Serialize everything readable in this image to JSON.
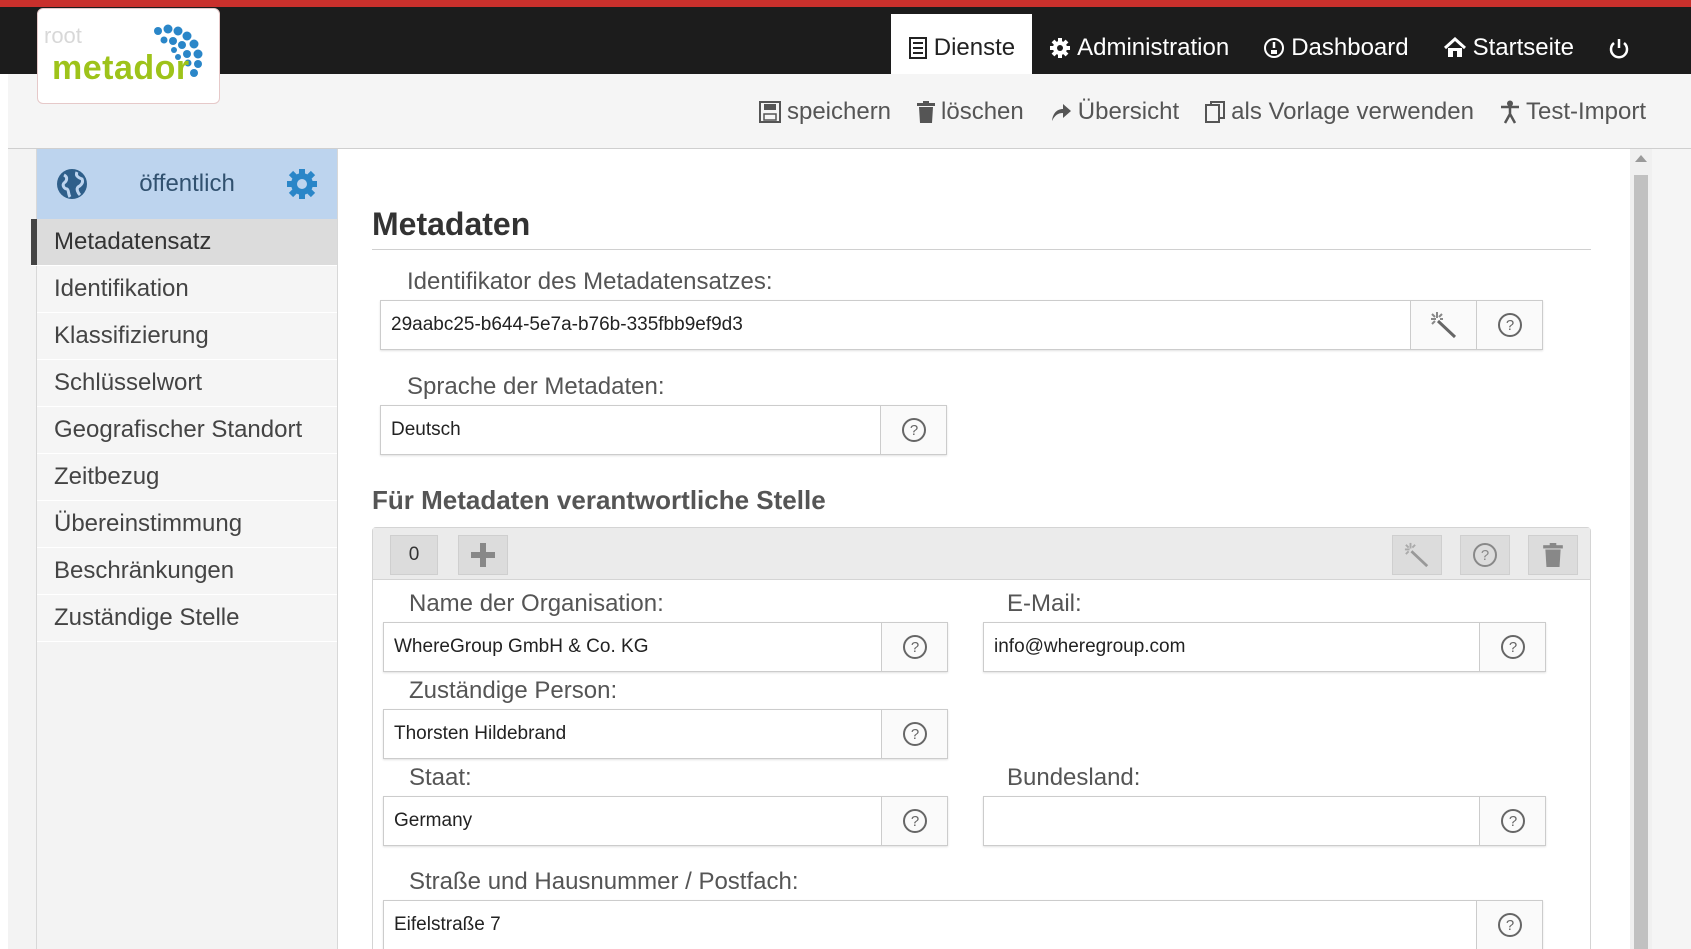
{
  "brand": {
    "user_label": "root",
    "name": "metador"
  },
  "nav": [
    {
      "label": "Dienste",
      "icon": "document-icon",
      "active": true
    },
    {
      "label": "Administration",
      "icon": "gear-icon"
    },
    {
      "label": "Dashboard",
      "icon": "gauge-icon"
    },
    {
      "label": "Startseite",
      "icon": "home-icon"
    },
    {
      "label": "",
      "icon": "power-icon"
    }
  ],
  "toolbar": [
    {
      "label": "speichern",
      "icon": "save-icon"
    },
    {
      "label": "löschen",
      "icon": "trash-icon"
    },
    {
      "label": "Übersicht",
      "icon": "share-arrow-icon"
    },
    {
      "label": "als Vorlage verwenden",
      "icon": "copy-icon"
    },
    {
      "label": "Test-Import",
      "icon": "person-icon"
    }
  ],
  "sidebar": {
    "visibility_label": "öffentlich",
    "items": [
      {
        "label": "Metadatensatz",
        "active": true
      },
      {
        "label": "Identifikation"
      },
      {
        "label": "Klassifizierung"
      },
      {
        "label": "Schlüsselwort"
      },
      {
        "label": "Geografischer Standort"
      },
      {
        "label": "Zeitbezug"
      },
      {
        "label": "Übereinstimmung"
      },
      {
        "label": "Beschränkungen"
      },
      {
        "label": "Zuständige Stelle"
      }
    ]
  },
  "main": {
    "title": "Metadaten",
    "identifier": {
      "label": "Identifikator des Metadatensatzes:",
      "value": "29aabc25-b644-5e7a-b76b-335fbb9ef9d3"
    },
    "language": {
      "label": "Sprache der Metadaten:",
      "value": "Deutsch"
    },
    "responsible": {
      "title": "Für Metadaten verantwortliche Stelle",
      "index_label": "0",
      "organisation": {
        "label": "Name der Organisation:",
        "value": "WhereGroup GmbH & Co. KG"
      },
      "email": {
        "label": "E-Mail:",
        "value": "info@wheregroup.com"
      },
      "person": {
        "label": "Zuständige Person:",
        "value": "Thorsten Hildebrand"
      },
      "country": {
        "label": "Staat:",
        "value": "Germany"
      },
      "state": {
        "label": "Bundesland:",
        "value": ""
      },
      "street": {
        "label": "Straße und Hausnummer / Postfach:",
        "value": "Eifelstraße 7"
      }
    }
  },
  "colors": {
    "accent_red": "#c9302c",
    "topbar": "#1c1c1c",
    "brand_green": "#9ec31a",
    "brand_blue": "#2a86c8",
    "sidebar_head": "#bdd4ee"
  }
}
